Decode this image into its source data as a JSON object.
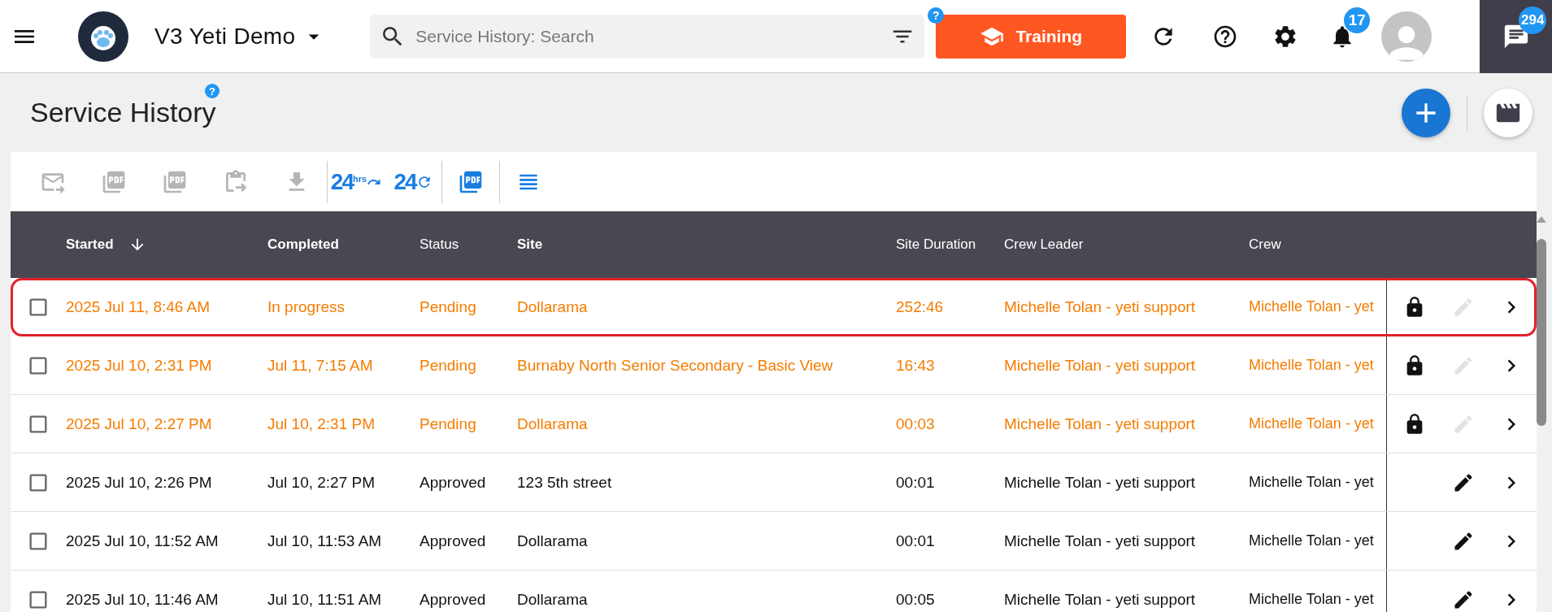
{
  "top_bar": {
    "company": "V3 Yeti Demo",
    "search": {
      "placeholder": "Service History: Search"
    },
    "help_badge": "?",
    "training_button": "Training",
    "notifications_count": "17",
    "messages_count": "294"
  },
  "page": {
    "title": "Service History",
    "help_badge": "?"
  },
  "toolbar": [
    {
      "kind": "email",
      "disabled": true
    },
    {
      "kind": "pdf-download",
      "disabled": true
    },
    {
      "kind": "pdf-send",
      "disabled": true
    },
    {
      "kind": "clipboard",
      "disabled": true
    },
    {
      "kind": "sheet-download",
      "disabled": true
    },
    {
      "kind": "divider"
    },
    {
      "kind": "last24",
      "label": "24",
      "sup": "hrs",
      "disabled": false
    },
    {
      "kind": "repeat24",
      "label": "24",
      "disabled": false
    },
    {
      "kind": "divider"
    },
    {
      "kind": "pdf",
      "disabled": false
    },
    {
      "kind": "divider"
    },
    {
      "kind": "columns",
      "disabled": false
    }
  ],
  "table": {
    "columns": [
      {
        "label": "Started",
        "sorted": true,
        "bold": true
      },
      {
        "label": "Completed",
        "sorted": false,
        "bold": true
      },
      {
        "label": "Status",
        "sorted": false,
        "bold": false
      },
      {
        "label": "Site",
        "sorted": false,
        "bold": true
      },
      {
        "label": "Site Duration",
        "sorted": false,
        "bold": false
      },
      {
        "label": "Crew Leader",
        "sorted": false,
        "bold": false
      },
      {
        "label": "Crew",
        "sorted": false,
        "bold": false
      }
    ],
    "rows": [
      {
        "checked": false,
        "kind": "pending",
        "highlighted": true,
        "locked": true,
        "editable": false,
        "started": "2025 Jul 11, 8:46 AM",
        "completed": "In progress",
        "status": "Pending",
        "site": "Dollarama",
        "duration": "252:46",
        "leader": "Michelle Tolan - yeti support",
        "crew": "Michelle Tolan - yet"
      },
      {
        "checked": false,
        "kind": "pending",
        "highlighted": false,
        "locked": true,
        "editable": false,
        "started": "2025 Jul 10, 2:31 PM",
        "completed": "Jul 11, 7:15 AM",
        "status": "Pending",
        "site": "Burnaby North Senior Secondary - Basic View",
        "duration": "16:43",
        "leader": "Michelle Tolan - yeti support",
        "crew": "Michelle Tolan - yet"
      },
      {
        "checked": false,
        "kind": "pending",
        "highlighted": false,
        "locked": true,
        "editable": false,
        "started": "2025 Jul 10, 2:27 PM",
        "completed": "Jul 10, 2:31 PM",
        "status": "Pending",
        "site": "Dollarama",
        "duration": "00:03",
        "leader": "Michelle Tolan - yeti support",
        "crew": "Michelle Tolan - yet"
      },
      {
        "checked": false,
        "kind": "approved",
        "highlighted": false,
        "locked": false,
        "editable": true,
        "started": "2025 Jul 10, 2:26 PM",
        "completed": "Jul 10, 2:27 PM",
        "status": "Approved",
        "site": "123 5th street",
        "duration": "00:01",
        "leader": "Michelle Tolan - yeti support",
        "crew": "Michelle Tolan - yet"
      },
      {
        "checked": false,
        "kind": "approved",
        "highlighted": false,
        "locked": false,
        "editable": true,
        "started": "2025 Jul 10, 11:52 AM",
        "completed": "Jul 10, 11:53 AM",
        "status": "Approved",
        "site": "Dollarama",
        "duration": "00:01",
        "leader": "Michelle Tolan - yeti support",
        "crew": "Michelle Tolan - yet"
      },
      {
        "checked": false,
        "kind": "approved",
        "highlighted": false,
        "locked": false,
        "editable": true,
        "started": "2025 Jul 10, 11:46 AM",
        "completed": "Jul 10, 11:51 AM",
        "status": "Approved",
        "site": "Dollarama",
        "duration": "00:05",
        "leader": "Michelle Tolan - yeti support",
        "crew": "Michelle Tolan - yet"
      }
    ]
  }
}
